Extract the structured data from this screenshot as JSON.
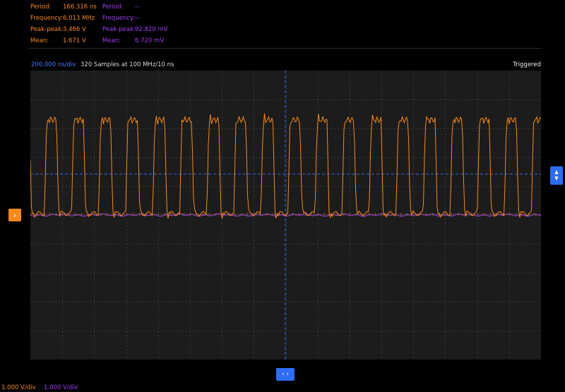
{
  "measurements": {
    "ch1": [
      {
        "label": "Period:",
        "value": "166.316 ns"
      },
      {
        "label": "Frequency:",
        "value": "6.013 MHz"
      },
      {
        "label": "Peak-peak:",
        "value": "3.466 V"
      },
      {
        "label": "Mean:",
        "value": "1.671 V"
      }
    ],
    "ch2": [
      {
        "label": "Period:",
        "value": "--"
      },
      {
        "label": "Frequency:",
        "value": "--"
      },
      {
        "label": "Peak-peak:",
        "value": "92.820 mV"
      },
      {
        "label": "Mean:",
        "value": "6.720 mV"
      }
    ]
  },
  "header": {
    "timebase": "200.000 ns/div",
    "samples": "320 Samples at 100 MHz/10 ns",
    "status": "Triggered"
  },
  "scales": {
    "ch1": "1.000 V/div",
    "ch2": "1.000 V/div"
  },
  "markers": {
    "ch1_icon": "chevron-right-icon",
    "trigger_icon": "chevron-up-down-icon",
    "time_icon": "chevron-left-right-icon"
  },
  "colors": {
    "ch1": "#f7891e",
    "ch2": "#a23cf0",
    "accent": "#2e6cf5",
    "plot_bg": "#1c1c1c",
    "grid": "#3a3a3a"
  }
}
